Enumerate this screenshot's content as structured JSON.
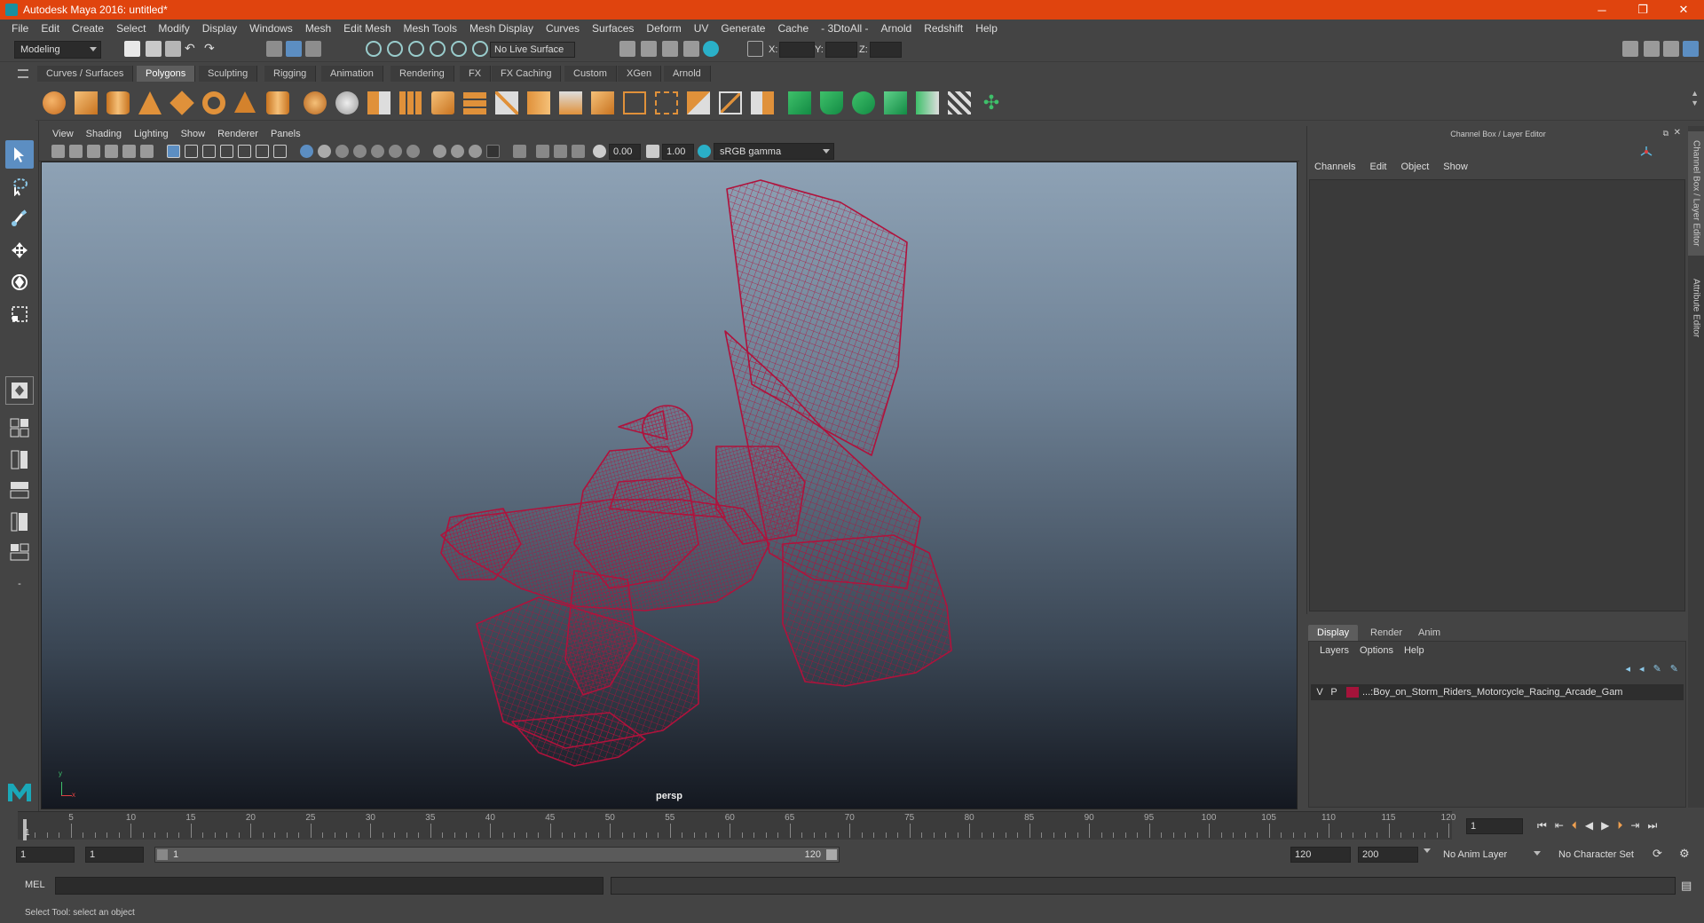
{
  "window": {
    "title": "Autodesk Maya 2016: untitled*",
    "controls": {
      "minimize": "─",
      "restore": "❐",
      "close": "✕"
    }
  },
  "menubar": [
    "File",
    "Edit",
    "Create",
    "Select",
    "Modify",
    "Display",
    "Windows",
    "Mesh",
    "Edit Mesh",
    "Mesh Tools",
    "Mesh Display",
    "Curves",
    "Surfaces",
    "Deform",
    "UV",
    "Generate",
    "Cache",
    "- 3DtoAll -",
    "Arnold",
    "Redshift",
    "Help"
  ],
  "statusline": {
    "mode": "Modeling",
    "live_surface": "No Live Surface",
    "x_label": "X:",
    "y_label": "Y:",
    "z_label": "Z:"
  },
  "shelf": {
    "tabs": [
      "Curves / Surfaces",
      "Polygons",
      "Sculpting",
      "Rigging",
      "Animation",
      "Rendering",
      "FX",
      "FX Caching",
      "Custom",
      "XGen",
      "Arnold"
    ],
    "active_tab": "Polygons"
  },
  "viewport": {
    "menu": [
      "View",
      "Shading",
      "Lighting",
      "Show",
      "Renderer",
      "Panels"
    ],
    "exposure": "0.00",
    "gamma": "1.00",
    "color_space": "sRGB gamma",
    "camera_label": "persp",
    "axis_x": "x",
    "axis_y": "y",
    "wire_color": "#b0123c"
  },
  "channelbox": {
    "header": "Channel Box / Layer Editor",
    "menu": [
      "Channels",
      "Edit",
      "Object",
      "Show"
    ]
  },
  "layers": {
    "tabs": [
      "Display",
      "Render",
      "Anim"
    ],
    "active_tab": "Display",
    "menu": [
      "Layers",
      "Options",
      "Help"
    ],
    "rows": [
      {
        "visible": "V",
        "playback": "P",
        "name": "...:Boy_on_Storm_Riders_Motorcycle_Racing_Arcade_Gam",
        "color": "#a5133a"
      }
    ]
  },
  "sidetabs": [
    "Channel Box / Layer Editor",
    "Attribute Editor"
  ],
  "timeslider": {
    "ticks": [
      "5",
      "10",
      "15",
      "20",
      "25",
      "30",
      "35",
      "40",
      "45",
      "50",
      "55",
      "60",
      "65",
      "70",
      "75",
      "80",
      "85",
      "90",
      "95",
      "100",
      "105",
      "110",
      "115",
      "120"
    ],
    "current_frame_marker": "1",
    "current_frame": "1"
  },
  "range": {
    "start": "1",
    "playback_start": "1",
    "slider_start": "1",
    "slider_end": "120",
    "playback_end": "120",
    "end": "200",
    "anim_layer": "No Anim Layer",
    "character_set": "No Character Set"
  },
  "commandline": {
    "label": "MEL"
  },
  "helpline": {
    "text": "Select Tool: select an object"
  }
}
